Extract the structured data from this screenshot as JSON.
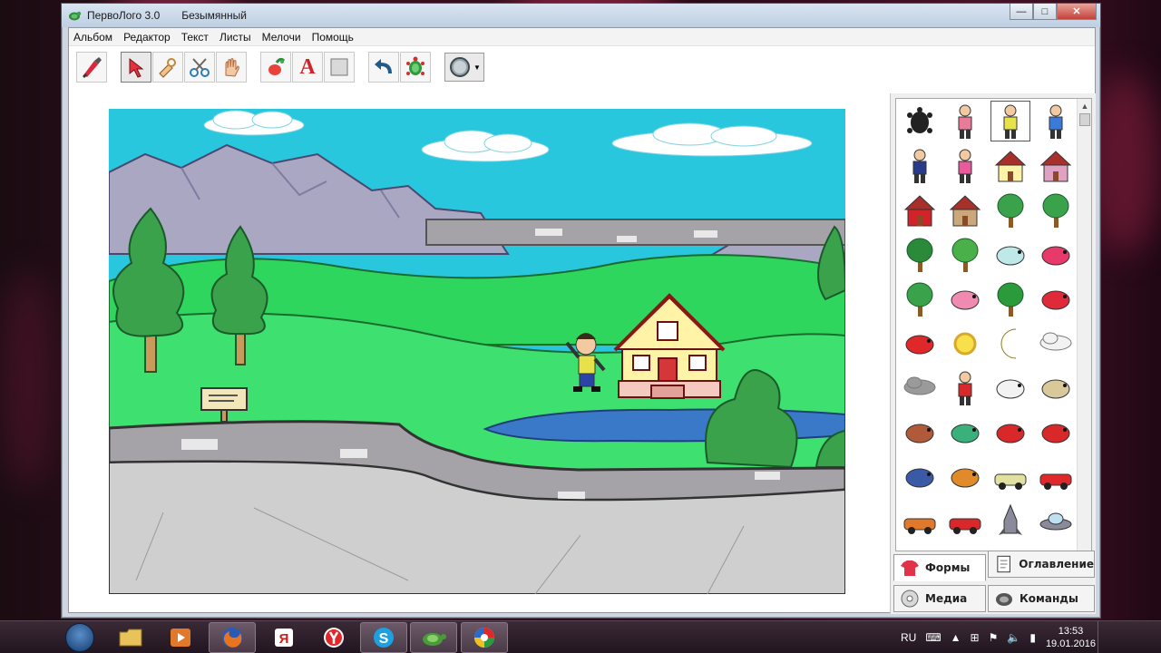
{
  "window": {
    "title": "ПервоЛого 3.0",
    "document": "Безымянный",
    "controls": {
      "minimize": "—",
      "maximize": "□",
      "close": "✕"
    }
  },
  "menu": [
    "Альбом",
    "Редактор",
    "Текст",
    "Листы",
    "Мелочи",
    "Помощь"
  ],
  "toolbar": [
    {
      "name": "brush-tool-icon",
      "selected": false
    },
    {
      "name": "arrow-select-icon",
      "selected": true
    },
    {
      "name": "hand-pick-icon",
      "selected": false
    },
    {
      "name": "scissors-icon",
      "selected": false
    },
    {
      "name": "stamp-hand-icon",
      "selected": false
    },
    {
      "name": "paint-bucket-icon",
      "selected": false
    },
    {
      "name": "text-tool-icon",
      "selected": false
    },
    {
      "name": "rectangle-tool-icon",
      "selected": false
    },
    {
      "name": "undo-icon",
      "selected": false
    },
    {
      "name": "turtle-icon",
      "selected": false
    }
  ],
  "text_tool_glyph": "A",
  "shape_dropdown": {
    "selected": "circle"
  },
  "palette": {
    "items": [
      "turtle",
      "girl",
      "boy",
      "girl-dress",
      "policeman",
      "tennis-girl",
      "house",
      "castle",
      "pagoda",
      "hut",
      "tree",
      "tree-small",
      "palm",
      "birch",
      "snow-mountain",
      "flowers",
      "leaves",
      "flower-pink",
      "fir",
      "roses",
      "tulip",
      "sun",
      "moon",
      "cloud",
      "storm-cloud",
      "santa",
      "dog",
      "lion",
      "cat",
      "fish",
      "bird-red",
      "bird-red-2",
      "dolphin",
      "butterfly",
      "car-beetle",
      "car-red",
      "tractor",
      "car-sport",
      "rocket",
      "ufo"
    ],
    "selected_index": 2
  },
  "tabs": {
    "forms": "Формы",
    "contents": "Оглавление",
    "media": "Медиа",
    "commands": "Команды"
  },
  "taskbar": {
    "apps": [
      "explorer",
      "media-player",
      "firefox",
      "yandex-mail",
      "yandex-browser",
      "skype",
      "pervologo",
      "chrome-like"
    ],
    "lang": "RU",
    "time": "13:53",
    "date": "19.01.2016"
  },
  "colors": {
    "sky": "#29c7dd",
    "grass": "#3ee06f",
    "path": "#cfcfcf",
    "mountain": "#a9a7c2",
    "water": "#3a78c8"
  }
}
